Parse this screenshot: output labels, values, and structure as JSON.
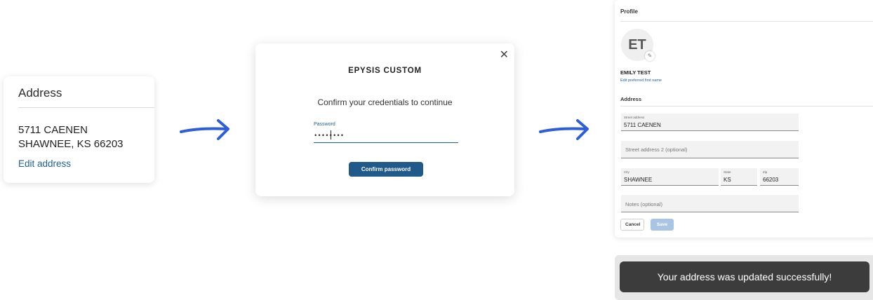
{
  "address_card": {
    "title": "Address",
    "line1": "5711 CAENEN",
    "line2": "SHAWNEE, KS 66203",
    "edit_link": "Edit address"
  },
  "modal": {
    "brand": "EPYSIS CUSTOM",
    "prompt": "Confirm your credentials to continue",
    "password_label": "Password",
    "password_value": "••••••••",
    "confirm_button": "Confirm password",
    "close_icon": "close-icon"
  },
  "profile": {
    "header": "Profile",
    "avatar_initials": "ET",
    "avatar_edit_icon": "pencil-icon",
    "name": "EMILY TEST",
    "edit_preferred": "Edit preferred first name",
    "section_title": "Address",
    "fields": {
      "street_label": "Street address",
      "street_value": "5711 CAENEN",
      "street2_placeholder": "Street address 2 (optional)",
      "city_label": "City",
      "city_value": "SHAWNEE",
      "state_label": "State",
      "state_value": "KS",
      "zip_label": "Zip",
      "zip_value": "66203",
      "notes_placeholder": "Notes (optional)"
    },
    "cancel_button": "Cancel",
    "save_button": "Save"
  },
  "toast": {
    "message": "Your address was updated successfully!"
  },
  "colors": {
    "link_blue": "#1f5f97",
    "primary_button": "#1f5a8b",
    "arrow_blue": "#2f5fd6",
    "save_disabled": "#a9c5e3",
    "toast_bg": "#3c3c3c"
  }
}
